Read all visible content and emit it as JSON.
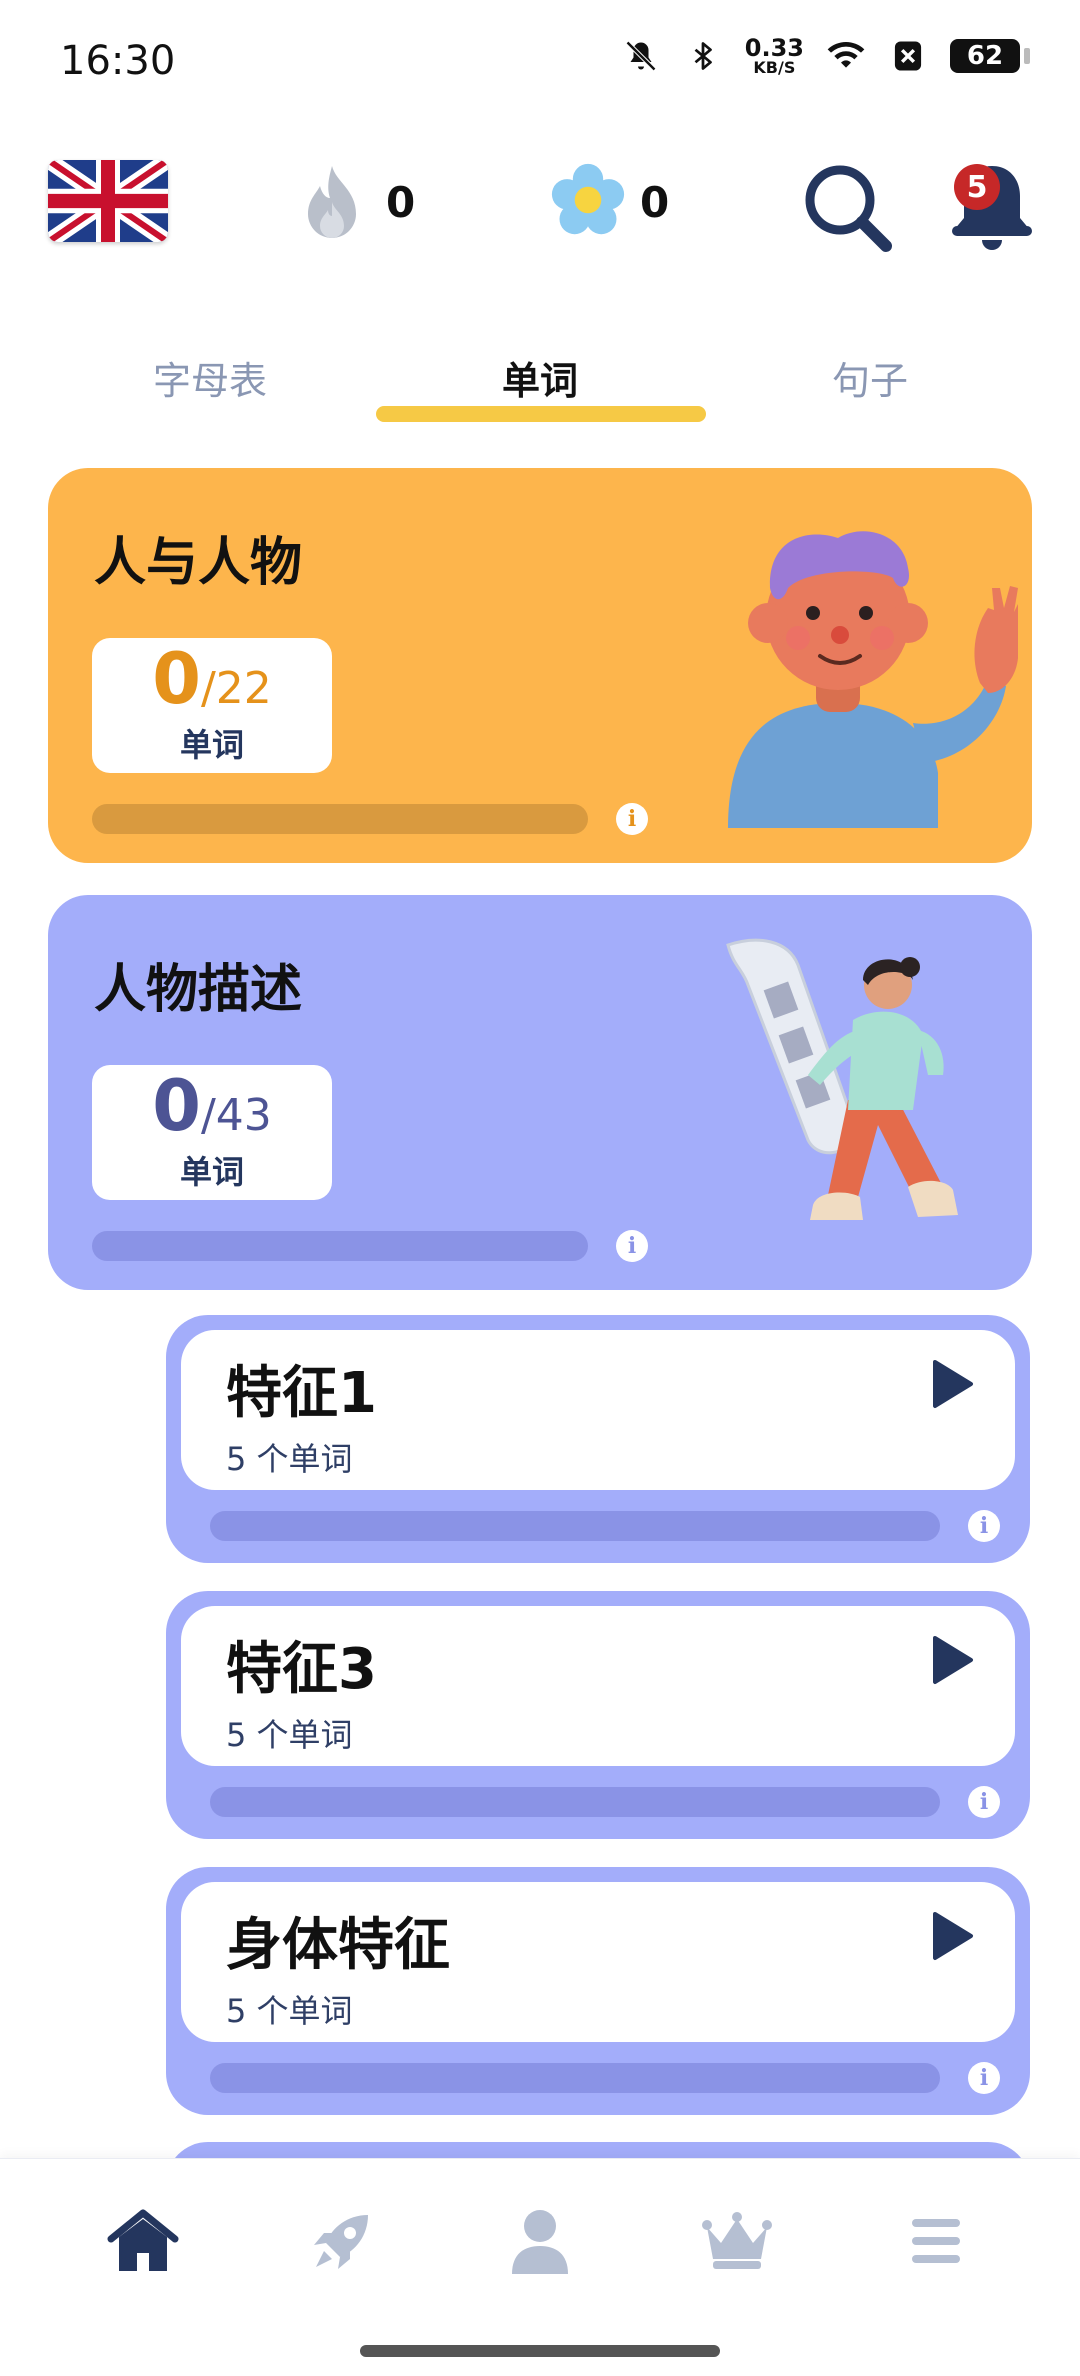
{
  "status_bar": {
    "time": "16:30",
    "net_speed_value": "0.33",
    "net_speed_unit": "KB/S",
    "battery": "62",
    "icons": [
      "bell-muted-icon",
      "bluetooth-icon",
      "wifi-icon",
      "x-box-icon"
    ]
  },
  "header": {
    "flag": "uk-flag-icon",
    "streak_count": "0",
    "flower_count": "0",
    "notification_badge": "5"
  },
  "tabs": [
    {
      "label": "字母表",
      "active": false
    },
    {
      "label": "单词",
      "active": true
    },
    {
      "label": "句子",
      "active": false
    }
  ],
  "categories": [
    {
      "title": "人与人物",
      "current": "0",
      "total": "/22",
      "unit": "单词",
      "progress": 0,
      "color": "#fdb54c"
    },
    {
      "title": "人物描述",
      "current": "0",
      "total": "/43",
      "unit": "单词",
      "progress": 0,
      "color": "#a3adfa"
    }
  ],
  "lessons": [
    {
      "title": "特征1",
      "subtitle": "5 个单词",
      "progress": 0
    },
    {
      "title": "特征3",
      "subtitle": "5 个单词",
      "progress": 0
    },
    {
      "title": "身体特征",
      "subtitle": "5 个单词",
      "progress": 0
    }
  ],
  "bottom_nav": [
    {
      "icon": "home-icon",
      "active": true
    },
    {
      "icon": "rocket-icon",
      "active": false
    },
    {
      "icon": "profile-icon",
      "active": false
    },
    {
      "icon": "crown-icon",
      "active": false
    },
    {
      "icon": "menu-icon",
      "active": false
    }
  ],
  "colors": {
    "accent_yellow": "#f6c945",
    "card_orange": "#fdb54c",
    "card_purple": "#a3adfa",
    "nav_active": "#24365e",
    "nav_inactive": "#b5bfd2"
  }
}
